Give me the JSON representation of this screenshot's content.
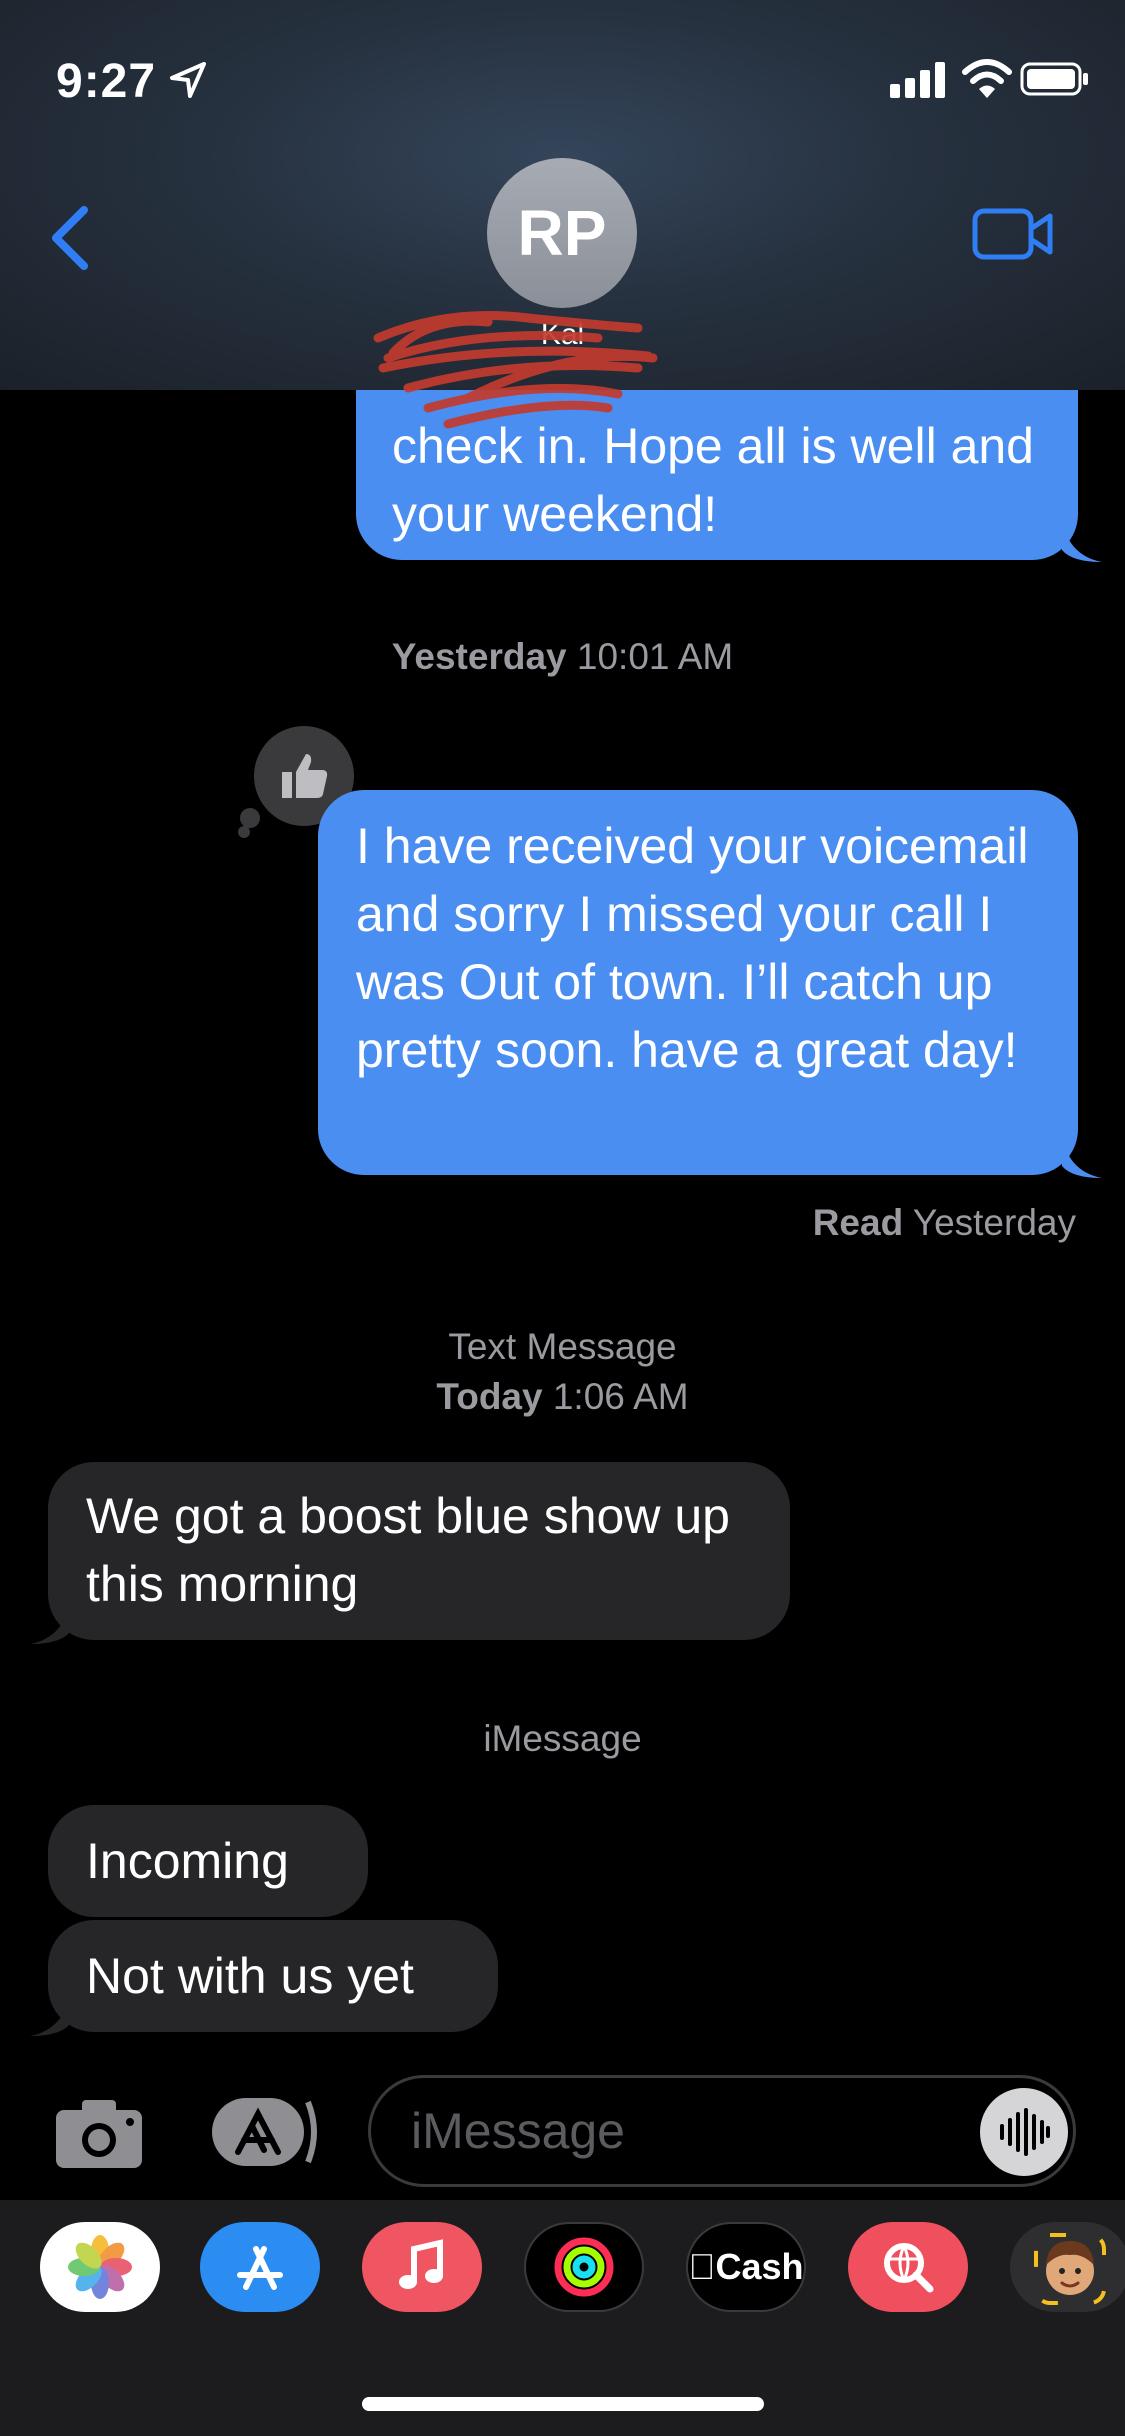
{
  "status_bar": {
    "time": "9:27"
  },
  "header": {
    "avatar_initials": "RP",
    "contact_name": "Kal"
  },
  "messages": {
    "msg1": {
      "text": "check in. Hope all is well and your weekend!",
      "direction": "outgoing"
    },
    "ts1": {
      "day": "Yesterday",
      "time": "10:01 AM"
    },
    "msg2": {
      "text": "I have received your voicemail and sorry I missed your call I was Out of town. I’ll catch up pretty soon. have a great day!",
      "direction": "outgoing",
      "tapback": "thumbs-up"
    },
    "read_receipt": {
      "label": "Read",
      "when": "Yesterday"
    },
    "ts2": {
      "service": "Text Message",
      "day": "Today",
      "time": "1:06 AM"
    },
    "msg3": {
      "text": "We got a boost blue show up this morning",
      "direction": "incoming"
    },
    "ts3": {
      "service": "iMessage"
    },
    "msg4": {
      "text": "Incoming",
      "direction": "incoming"
    },
    "msg5": {
      "text": "Not with us yet",
      "direction": "incoming"
    }
  },
  "composer": {
    "placeholder": "iMessage"
  },
  "app_drawer": {
    "apps": [
      {
        "name": "Photos",
        "icon": "photos-icon"
      },
      {
        "name": "App Store",
        "icon": "app-store-icon"
      },
      {
        "name": "Music",
        "icon": "music-icon"
      },
      {
        "name": "Activity",
        "icon": "activity-rings-icon"
      },
      {
        "name": "Apple Cash",
        "icon": "apple-cash-icon",
        "label": "Cash"
      },
      {
        "name": "Images",
        "icon": "image-search-icon"
      },
      {
        "name": "Memoji",
        "icon": "memoji-icon"
      }
    ]
  },
  "colors": {
    "outgoing": "#4a8ef2",
    "incoming": "#262628",
    "accent": "#2f7ef6",
    "background": "#000000"
  }
}
